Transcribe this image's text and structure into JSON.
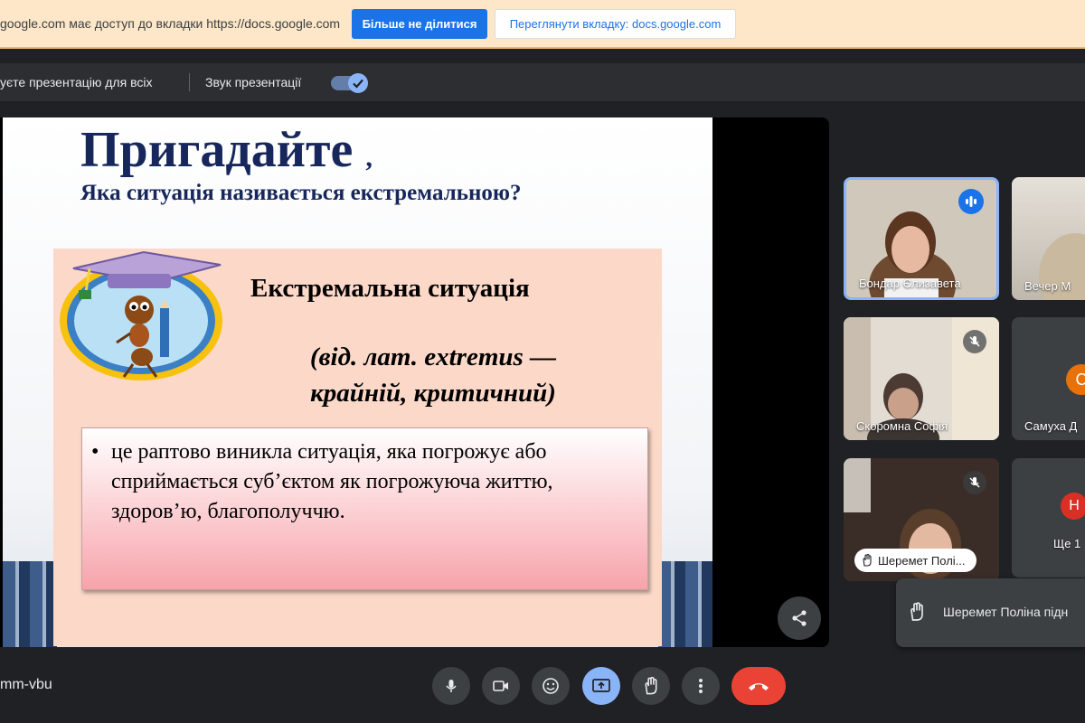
{
  "share_banner": {
    "message": "google.com має доступ до вкладки https://docs.google.com",
    "stop_sharing": "Більше не ділитися",
    "view_tab": "Переглянути вкладку: docs.google.com"
  },
  "presenting_bar": {
    "status": "уєте презентацію для всіх",
    "audio_label": "Звук презентації",
    "audio_enabled": true
  },
  "slide": {
    "title": "Пригадайте",
    "title_comma": ",",
    "question": "Яка ситуація називається екстремальною?",
    "heading": "Екстремальна ситуація",
    "latin_line1": "(від. лат.  extremus —",
    "latin_line2": "крайній, критичний)",
    "bullet": "•",
    "definition": "це раптово виникла ситуація, яка погрожує або сприймається суб’єктом як погрожуюча життю, здоров’ю, благополуччю."
  },
  "participants": [
    {
      "name": "Бондар Єлизавета",
      "speaking": true
    },
    {
      "name": "Вечер М",
      "muted": false
    },
    {
      "name": "Скоромна Софія",
      "muted": true
    },
    {
      "name": "Самуха Д",
      "initial": "С",
      "avatar_color": "#e8710a"
    },
    {
      "name": "Шеремет Полі...",
      "muted": true,
      "hand_raised": true
    },
    {
      "name": "Ще 1",
      "initial": "Н",
      "avatar_color": "#d93025"
    }
  ],
  "notification": {
    "hand_raised_text": "Шеремет Поліна підн"
  },
  "bottom_bar": {
    "meeting_code": "mm-vbu",
    "icons": [
      "mic-icon",
      "camera-icon",
      "emoji-icon",
      "present-icon",
      "raise-hand-icon",
      "more-icon",
      "end-call-icon"
    ]
  },
  "colors": {
    "accent": "#1a73e8",
    "end_call": "#ea4335",
    "slide_title": "#17275c",
    "panel": "#fbd8c8"
  }
}
